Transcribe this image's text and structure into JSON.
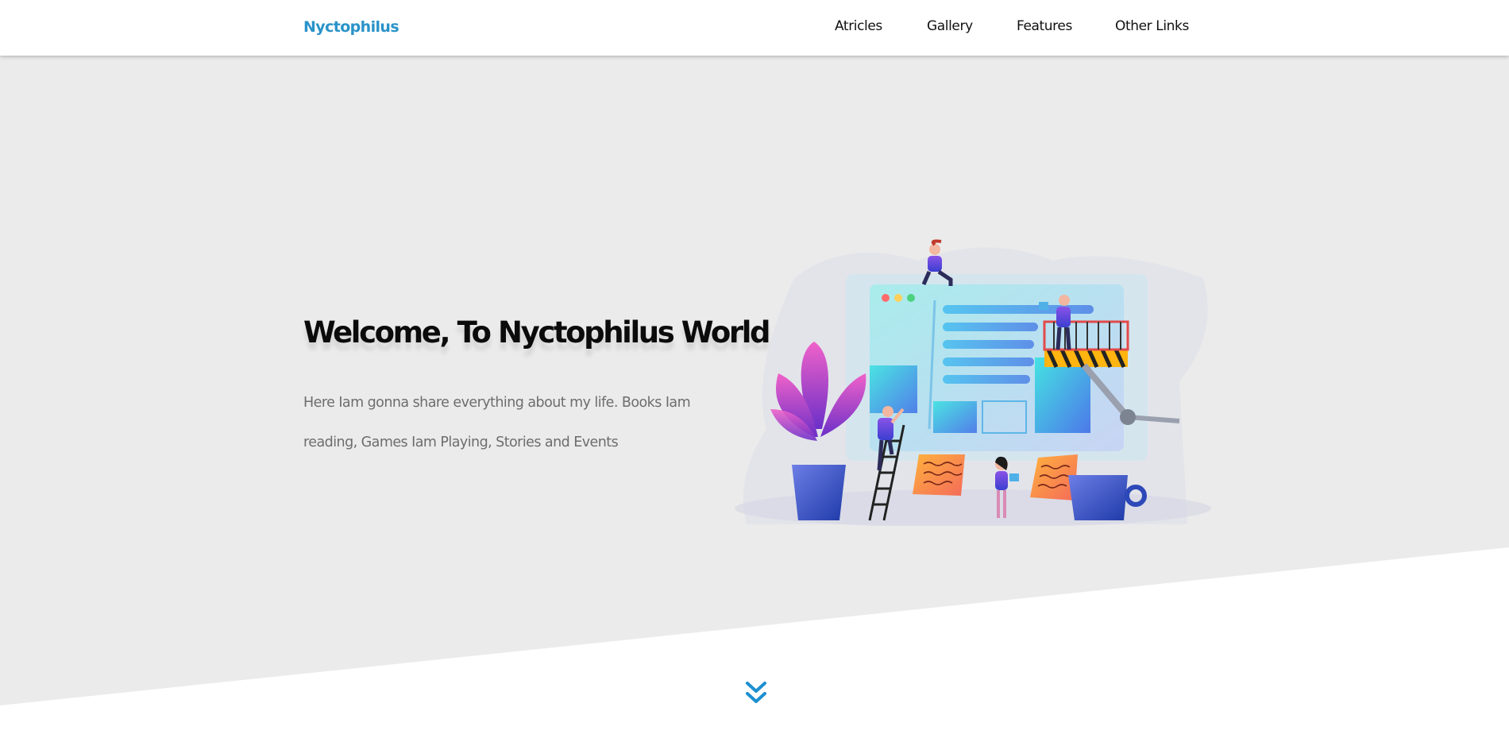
{
  "header": {
    "brand": "Nyctophilus",
    "nav": {
      "articles": "Atricles",
      "gallery": "Gallery",
      "features": "Features",
      "other_links": "Other Links"
    }
  },
  "hero": {
    "title": "Welcome, To Nyctophilus World",
    "description": "Here Iam gonna share everything about my life. Books Iam reading, Games Iam Playing, Stories and Events"
  },
  "icons": {
    "scroll": "double-chevron-down-icon"
  },
  "colors": {
    "brand": "#2a93c9",
    "hero_background": "#ebebeb",
    "accent_blue": "#1d8fd0",
    "text_dark": "#0b0b0b",
    "text_muted": "#6d6d6d"
  }
}
